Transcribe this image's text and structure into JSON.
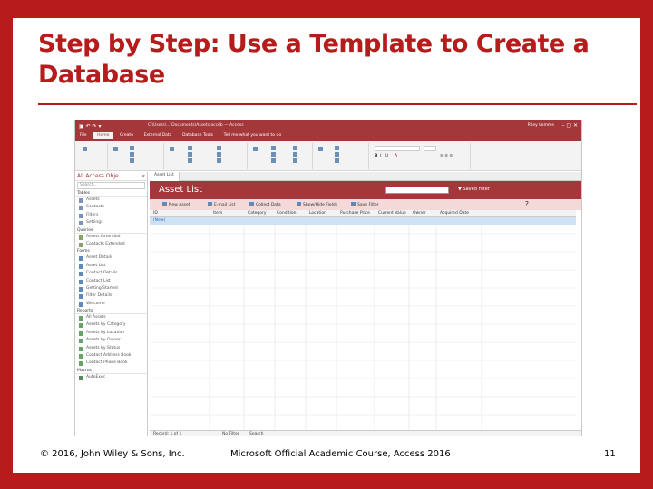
{
  "slide": {
    "title": "Step by Step: Use a Template to Create a Database",
    "footer_left": "© 2016, John Wiley & Sons, Inc.",
    "footer_center": "Microsoft Official Academic Course, Access 2016",
    "page_number": "11"
  },
  "access": {
    "user": "Riley Lemme",
    "ribbon_tabs": [
      "File",
      "Home",
      "Create",
      "External Data",
      "Database Tools",
      "Tell me what you want to do"
    ],
    "nav": {
      "header": "All Access Obje...",
      "search_placeholder": "Search...",
      "categories": {
        "tables": "Tables",
        "queries": "Queries",
        "forms": "Forms",
        "reports": "Reports",
        "macros": "Macros"
      },
      "tables": [
        "Assets",
        "Contacts",
        "Filters",
        "Settings"
      ],
      "queries": [
        "Assets Extended",
        "Contacts Extended"
      ],
      "forms": [
        "Asset Details",
        "Asset List",
        "Contact Details",
        "Contact List",
        "Getting Started",
        "Filter Details",
        "Welcome"
      ],
      "reports": [
        "All Assets",
        "Assets by Category",
        "Assets by Location",
        "Assets by Owner",
        "Assets by Status",
        "Contact Address Book",
        "Contact Phone Book"
      ],
      "macros": [
        "AutoExec"
      ]
    },
    "doc_tab": "Asset List",
    "form_title": "Asset List",
    "form_buttons": [
      "New Asset",
      "E-mail List",
      "Collect Data",
      "Show/Hide Fields",
      "Save Filter"
    ],
    "filter_label": "Saved Filter",
    "help_mark": "?",
    "columns": [
      "ID",
      "Item",
      "Category",
      "Condition",
      "Location",
      "Purchase Price",
      "Current Value",
      "Owner",
      "Acquired Date"
    ],
    "new_row_label": "(New)",
    "status": {
      "record": "Record: 1 of 1",
      "filter": "No Filter",
      "search": "Search"
    }
  }
}
